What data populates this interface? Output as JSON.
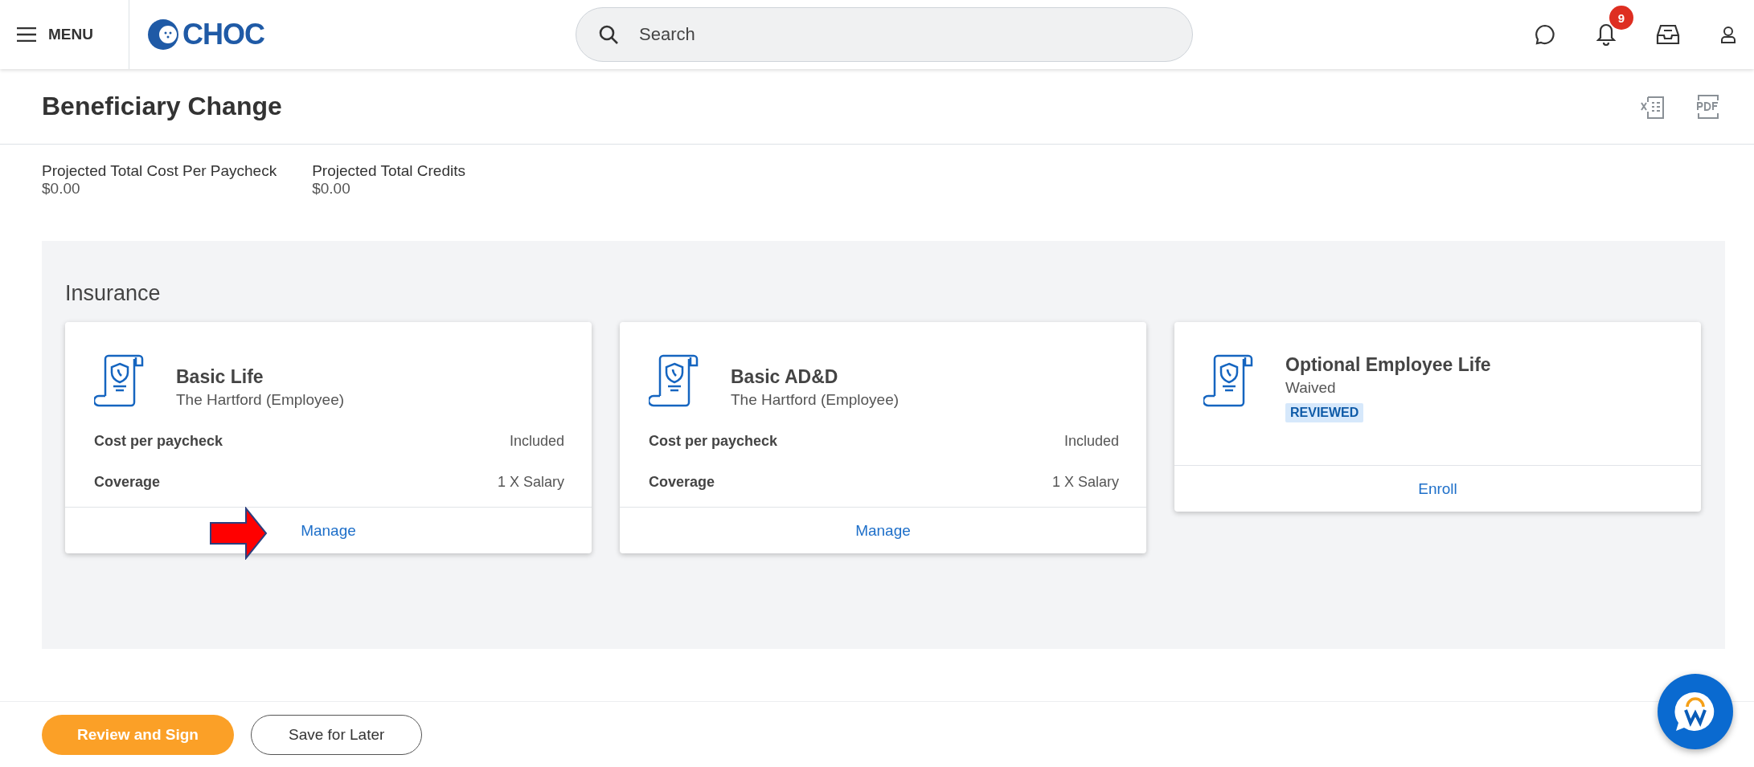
{
  "topbar": {
    "menu_label": "MENU",
    "logo_text": "CHOC",
    "search": {
      "placeholder": "Search"
    },
    "notification_count": "9"
  },
  "page": {
    "title": "Beneficiary Change"
  },
  "summary": [
    {
      "label": "Projected Total Cost Per Paycheck",
      "value": "$0.00"
    },
    {
      "label": "Projected Total Credits",
      "value": "$0.00"
    }
  ],
  "section": {
    "title": "Insurance",
    "cards": [
      {
        "title": "Basic Life",
        "subtitle": "The Hartford (Employee)",
        "rows": [
          {
            "label": "Cost per paycheck",
            "value": "Included"
          },
          {
            "label": "Coverage",
            "value": "1 X Salary"
          }
        ],
        "action": "Manage",
        "pointed_at": true
      },
      {
        "title": "Basic AD&D",
        "subtitle": "The Hartford (Employee)",
        "rows": [
          {
            "label": "Cost per paycheck",
            "value": "Included"
          },
          {
            "label": "Coverage",
            "value": "1 X Salary"
          }
        ],
        "action": "Manage",
        "pointed_at": false
      },
      {
        "title": "Optional Employee Life",
        "subtitle": "Waived",
        "status": "REVIEWED",
        "action": "Enroll",
        "pointed_at": false
      }
    ]
  },
  "footer": {
    "buttons": [
      {
        "label": "Review and Sign",
        "kind": "primary"
      },
      {
        "label": "Save for Later",
        "kind": "secondary"
      }
    ]
  }
}
